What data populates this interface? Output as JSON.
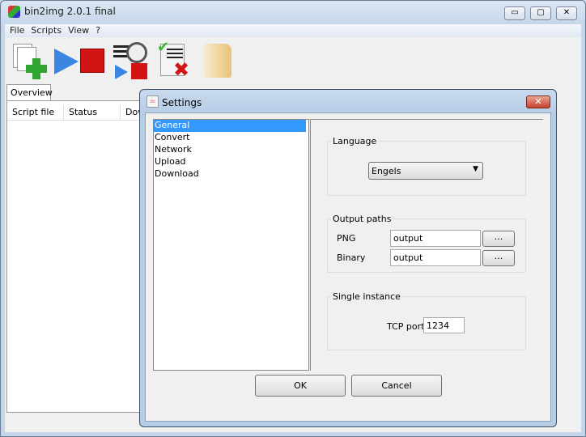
{
  "window": {
    "title": "bin2img 2.0.1 final",
    "minimize": "▭",
    "maximize": "▢",
    "close": "✕"
  },
  "menu": [
    "File",
    "Scripts",
    "View",
    "?"
  ],
  "toolbar": [
    "add-scripts-icon",
    "start-icon",
    "stop-icon",
    "schedule-icon",
    "clear-finished-icon",
    "open-folder-icon"
  ],
  "tabs": [
    "Overview"
  ],
  "table": {
    "columns": [
      "Script file",
      "Status",
      "Dow"
    ]
  },
  "dialog": {
    "title": "Settings",
    "categories": [
      "General",
      "Convert",
      "Network",
      "Upload",
      "Download"
    ],
    "selected": "General",
    "language": {
      "label": "Language",
      "value": "Engels"
    },
    "output_paths": {
      "label": "Output paths",
      "png_label": "PNG",
      "png_value": "output",
      "binary_label": "Binary",
      "binary_value": "output",
      "browse": "..."
    },
    "single_instance": {
      "label": "Single instance",
      "port_label": "TCP port",
      "port_value": "1234"
    },
    "ok": "OK",
    "cancel": "Cancel"
  }
}
